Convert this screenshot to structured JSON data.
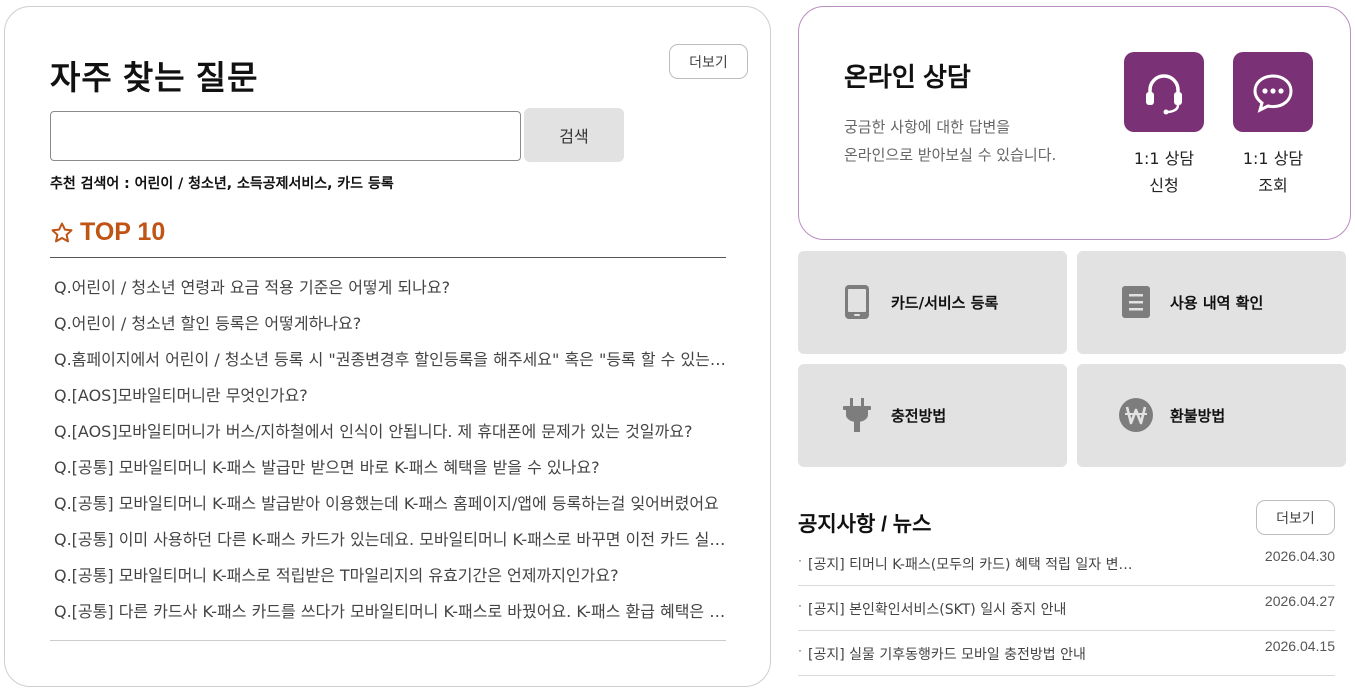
{
  "faq": {
    "title": "자주 찾는 질문",
    "more_label": "더보기",
    "search": {
      "placeholder": "",
      "button_label": "검색"
    },
    "recommended": "추천 검색어 : 어린이 / 청소년, 소득공제서비스, 카드 등록",
    "top_label": "TOP 10",
    "accent_color": "#c05414",
    "questions": [
      "Q.어린이 / 청소년 연령과 요금 적용 기준은 어떻게 되나요?",
      "Q.어린이 / 청소년 할인 등록은 어떻게하나요?",
      "Q.홈페이지에서 어린이 / 청소년 등록 시 \"권종변경후 할인등록을 해주세요\" 혹은 \"등록 할 수 있는 카드가 아닙니다\"라는 문구가 나와요",
      "Q.[AOS]모바일티머니란 무엇인가요?",
      "Q.[AOS]모바일티머니가 버스/지하철에서 인식이 안됩니다. 제 휴대폰에 문제가 있는 것일까요?",
      "Q.[공통] 모바일티머니 K-패스 발급만 받으면 바로 K-패스 혜택을 받을 수 있나요?",
      "Q.[공통] 모바일티머니 K-패스 발급받아 이용했는데 K-패스 홈페이지/앱에 등록하는걸 잊어버렸어요",
      "Q.[공통] 이미 사용하던 다른 K-패스 카드가 있는데요. 모바일티머니 K-패스로 바꾸면 이전 카드 실적은 어떻게 되나요?",
      "Q.[공통] 모바일티머니 K-패스로 적립받은 T마일리지의 유효기간은 언제까지인가요?",
      "Q.[공통] 다른 카드사 K-패스 카드를 쓰다가 모바일티머니 K-패스로 바꿨어요. K-패스 환급 혜택은 어떻게 되나요?"
    ]
  },
  "consult": {
    "title": "온라인 상담",
    "desc_line1": "궁금한 사항에 대한 답변을",
    "desc_line2": "온라인으로 받아보실 수 있습니다.",
    "brand_color": "#7b3175",
    "tiles": [
      {
        "icon": "headset-icon",
        "line1": "1:1 상담",
        "line2": "신청"
      },
      {
        "icon": "chat-bubble-icon",
        "line1": "1:1 상담",
        "line2": "조회"
      }
    ]
  },
  "quick_menu": [
    {
      "icon": "phone-icon",
      "label": "카드/서비스 등록"
    },
    {
      "icon": "document-icon",
      "label": "사용 내역 확인"
    },
    {
      "icon": "plug-icon",
      "label": "충전방법"
    },
    {
      "icon": "won-icon",
      "label": "환불방법"
    }
  ],
  "notices": {
    "title": "공지사항 / 뉴스",
    "more_label": "더보기",
    "items": [
      {
        "text": "[공지] 티머니 K-패스(모두의 카드) 혜택 적립 일자 변경 안내",
        "date": "2026.04.30"
      },
      {
        "text": "[공지] 본인확인서비스(SKT) 일시 중지 안내",
        "date": "2026.04.27"
      },
      {
        "text": "[공지] 실물 기후동행카드 모바일 충전방법 안내",
        "date": "2026.04.15"
      }
    ]
  }
}
